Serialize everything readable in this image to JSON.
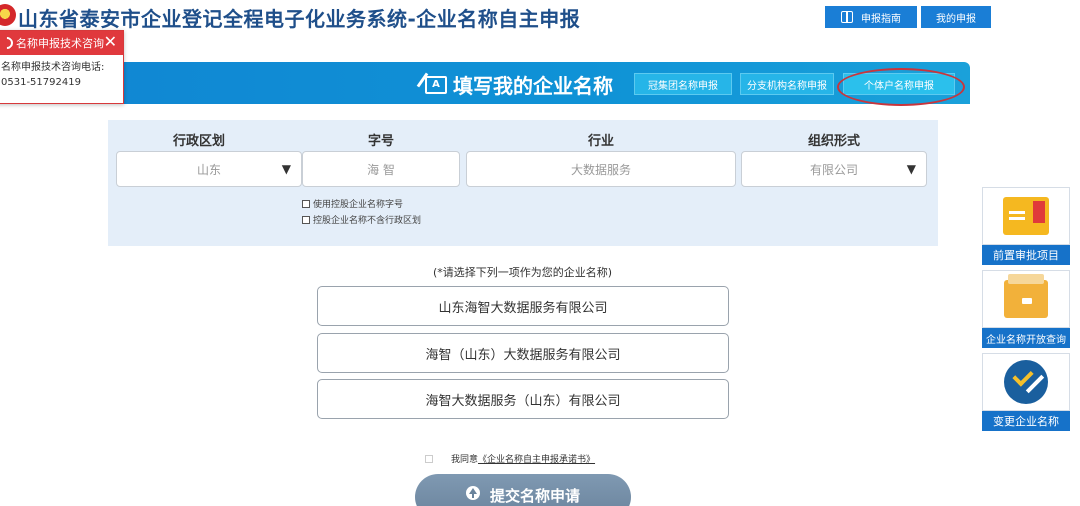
{
  "header": {
    "app_title": "山东省泰安市企业登记全程电子化业务系统-企业名称自主申报",
    "guide_button": "申报指南",
    "mine_button": "我的申报"
  },
  "consult_popup": {
    "title": "名称申报技术咨询",
    "line1": "名称申报技术咨询电话:",
    "phone": "0531-51792419"
  },
  "banner": {
    "title": "填写我的企业名称",
    "tabs": [
      {
        "label": "冠集团名称申报"
      },
      {
        "label": "分支机构名称申报"
      },
      {
        "label": "个体户名称申报"
      }
    ]
  },
  "form": {
    "headers": {
      "region": "行政区划",
      "trade_name": "字号",
      "industry": "行业",
      "org_form": "组织形式"
    },
    "values": {
      "region": "山东",
      "trade_name": "海 智",
      "industry": "大数据服务",
      "org_form": "有限公司"
    },
    "checkbox1": "使用控股企业名称字号",
    "checkbox2": "控股企业名称不含行政区划"
  },
  "names": {
    "hint": "(*请选择下列一项作为您的企业名称)",
    "options": [
      "山东海智大数据服务有限公司",
      "海智（山东）大数据服务有限公司",
      "海智大数据服务（山东）有限公司"
    ]
  },
  "agreement": {
    "prefix": "我同意",
    "link": "《企业名称自主申报承诺书》"
  },
  "submit": {
    "label": "提交名称申请"
  },
  "side_panel": {
    "items": [
      {
        "label": "前置审批项目",
        "icon": "folder-icon"
      },
      {
        "label": "企业名称开放查询",
        "icon": "drawer-icon"
      },
      {
        "label": "变更企业名称",
        "icon": "check-icon"
      }
    ]
  }
}
